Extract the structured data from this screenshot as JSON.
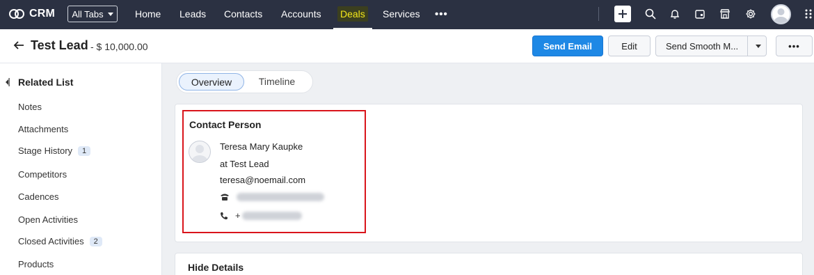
{
  "app": {
    "name": "CRM"
  },
  "topnav": {
    "all_tabs_label": "All Tabs",
    "items": [
      "Home",
      "Leads",
      "Contacts",
      "Accounts",
      "Deals",
      "Services"
    ],
    "active": "Deals",
    "more_label": "•••"
  },
  "record": {
    "title": "Test Lead",
    "amount": "- $ 10,000.00"
  },
  "actions": {
    "send_email": "Send Email",
    "edit": "Edit",
    "send_smooth": "Send Smooth M...",
    "more": "•••"
  },
  "sidebar": {
    "heading": "Related List",
    "items": [
      {
        "label": "Notes",
        "count": ""
      },
      {
        "label": "Attachments",
        "count": ""
      },
      {
        "label": "Stage History",
        "count": "1"
      },
      {
        "label": "Competitors",
        "count": ""
      },
      {
        "label": "Cadences",
        "count": ""
      },
      {
        "label": "Open Activities",
        "count": ""
      },
      {
        "label": "Closed Activities",
        "count": "2"
      },
      {
        "label": "Products",
        "count": ""
      }
    ]
  },
  "tabs": {
    "overview": "Overview",
    "timeline": "Timeline",
    "active": "Overview"
  },
  "contact_person": {
    "heading": "Contact Person",
    "name": "Teresa Mary Kaupke",
    "company": "at Test Lead",
    "email": "teresa@noemail.com",
    "mobile_prefix": "+"
  },
  "details_toggle": "Hide Details",
  "colors": {
    "topbar_bg": "#2b3142",
    "primary": "#1e88e5",
    "highlight_border": "#d9141b",
    "deals_highlight": "#f5e81a"
  }
}
